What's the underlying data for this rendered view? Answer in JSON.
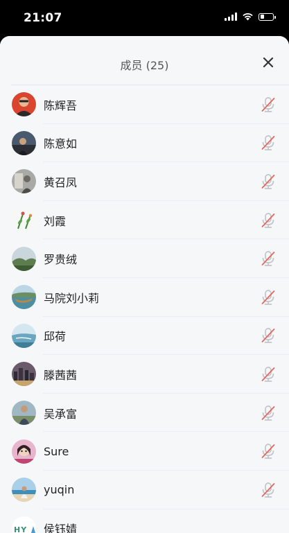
{
  "status_bar": {
    "time": "21:07",
    "battery_level": 0.3
  },
  "header": {
    "title": "成员 (25)"
  },
  "colors": {
    "muted_mic": "#e2675f",
    "mic_body": "#c2c4c8",
    "sheet_bg": "#f6f7f9"
  },
  "members": [
    {
      "name": "陈辉吾",
      "muted": true,
      "avatar": "portrait-red"
    },
    {
      "name": "陈意如",
      "muted": true,
      "avatar": "dark-photo"
    },
    {
      "name": "黄召凤",
      "muted": true,
      "avatar": "grey-photo"
    },
    {
      "name": "刘霞",
      "muted": true,
      "avatar": "flower-sketch"
    },
    {
      "name": "罗贵绒",
      "muted": true,
      "avatar": "landscape-green"
    },
    {
      "name": "马院刘小莉",
      "muted": true,
      "avatar": "landscape-boat"
    },
    {
      "name": "邱荷",
      "muted": true,
      "avatar": "lake-blue"
    },
    {
      "name": "滕茜茜",
      "muted": true,
      "avatar": "city-dark"
    },
    {
      "name": "吴承富",
      "muted": true,
      "avatar": "person-outdoor"
    },
    {
      "name": "Sure",
      "muted": true,
      "avatar": "girl-pink"
    },
    {
      "name": "yuqin",
      "muted": true,
      "avatar": "beach-person"
    },
    {
      "name": "侯钰婧",
      "muted": false,
      "avatar": "logo-hy"
    }
  ],
  "logo_text": "HY"
}
